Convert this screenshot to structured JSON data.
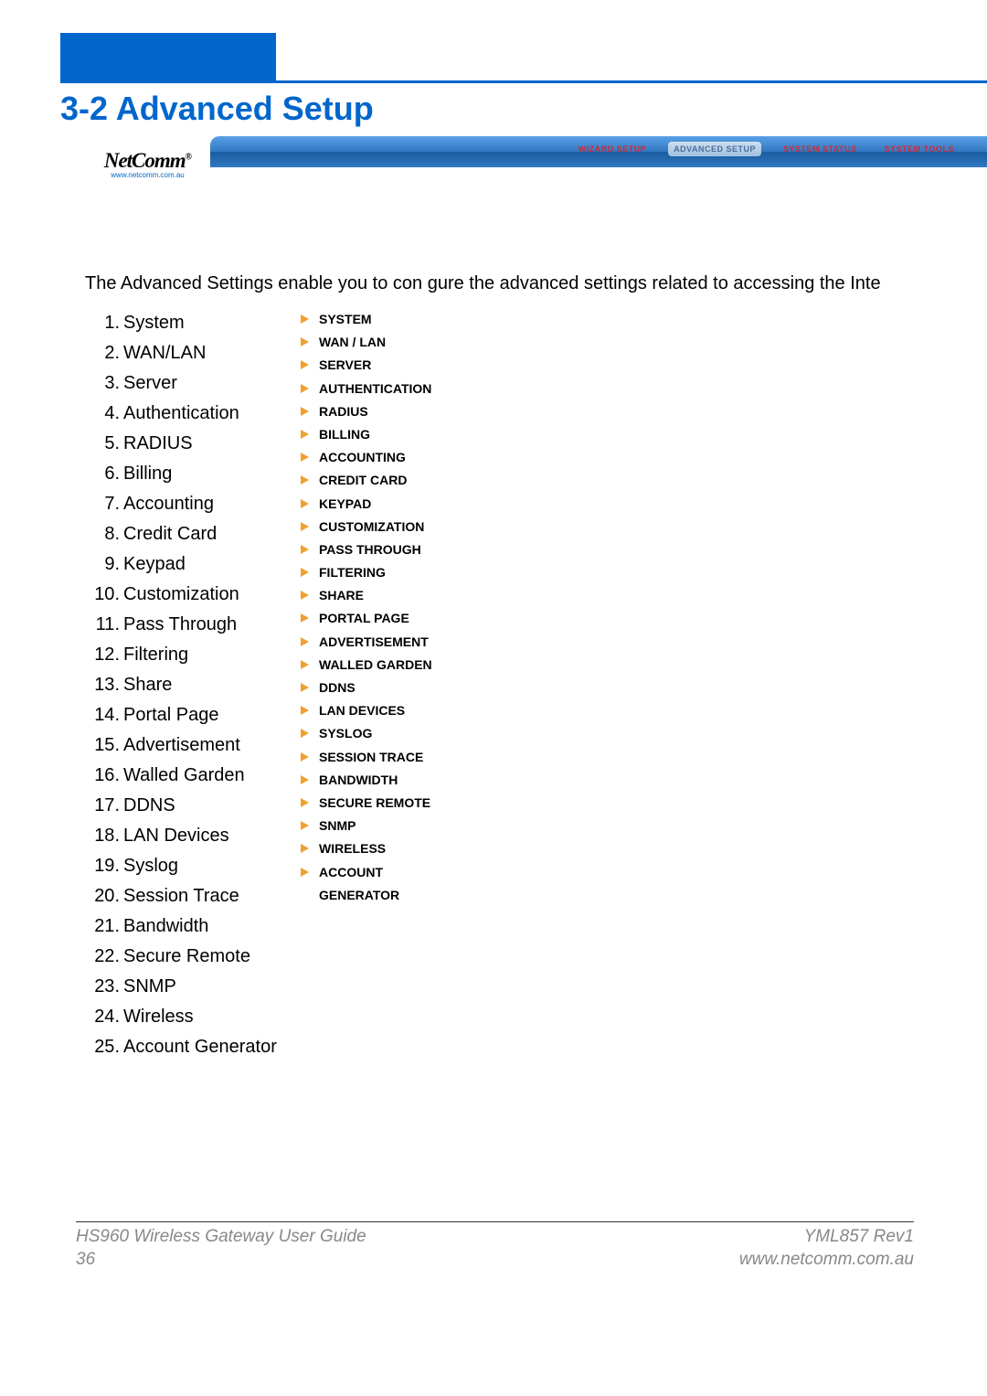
{
  "heading": "3-2 Advanced Setup",
  "logo": {
    "name": "NetComm",
    "url": "www.netcomm.com.au"
  },
  "tabs": {
    "wizard": "WIZARD SETUP",
    "advanced": "ADVANCED SETUP",
    "status": "SYSTEM STATUS",
    "tools": "SYSTEM TOOLS"
  },
  "intro": "The Advanced Settings enable you to con gure the advanced settings related to accessing the Inte",
  "text_items": [
    "System",
    "WAN/LAN",
    "Server",
    "Authentication",
    "RADIUS",
    "Billing",
    "Accounting",
    "Credit Card",
    "Keypad",
    "Customization",
    "Pass Through",
    "Filtering",
    "Share",
    "Portal Page",
    "Advertisement",
    "Walled Garden",
    "DDNS",
    "LAN Devices",
    "Syslog",
    "Session Trace",
    "Bandwidth",
    "Secure Remote",
    "SNMP",
    "Wireless",
    "Account Generator"
  ],
  "menu_items": [
    "SYSTEM",
    "WAN / LAN",
    "SERVER",
    "AUTHENTICATION",
    "RADIUS",
    "BILLING",
    "ACCOUNTING",
    "CREDIT CARD",
    "KEYPAD",
    "CUSTOMIZATION",
    "PASS THROUGH",
    "FILTERING",
    "SHARE",
    "PORTAL PAGE",
    "ADVERTISEMENT",
    "WALLED GARDEN",
    "DDNS",
    "LAN DEVICES",
    "SYSLOG",
    "SESSION TRACE",
    "BANDWIDTH",
    "SECURE REMOTE",
    "SNMP",
    "WIRELESS",
    "ACCOUNT\nGENERATOR"
  ],
  "footer": {
    "guide": "HS960 Wireless Gateway User Guide",
    "page": "36",
    "rev": "YML857 Rev1",
    "site": "www.netcomm.com.au"
  }
}
